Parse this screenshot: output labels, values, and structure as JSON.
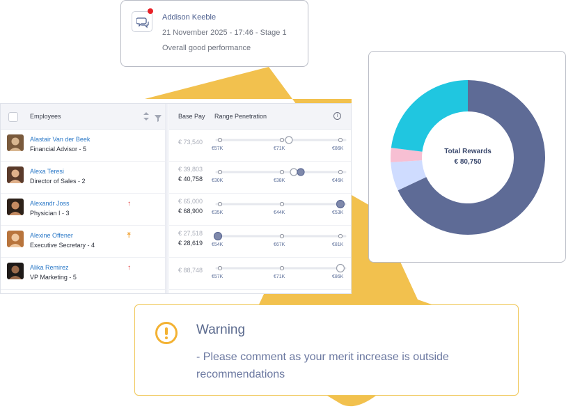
{
  "colors": {
    "accent_yellow": "#f2c14e",
    "link_blue": "#2a78c7",
    "navy": "#5e6b96",
    "warning": "#f3b233",
    "alert_red": "#e23a3a",
    "alert_orange": "#f0a030"
  },
  "notification": {
    "icon": "chat-icon",
    "name": "Addison Keeble",
    "meta": "21 November 2025 - 17:46 - Stage 1",
    "note": "Overall good performance"
  },
  "table": {
    "headers": {
      "employees": "Employees",
      "base_pay": "Base Pay",
      "range_penetration": "Range Penetration",
      "info_icon": "i"
    },
    "rows": [
      {
        "name": "Alastair Van der Beek",
        "title": "Financial Advisor - 5",
        "flag": "",
        "base_old": "€ 73,540",
        "base_new": "",
        "ticks": [
          "€57K",
          "€71K",
          "€86K"
        ],
        "marker": "€71K"
      },
      {
        "name": "Alexa Teresi",
        "title": "Director of Sales - 2",
        "flag": "",
        "base_old": "€ 39,803",
        "base_new": "€ 40,758",
        "ticks": [
          "€30K",
          "€38K",
          "€46K"
        ],
        "marker": "€38K"
      },
      {
        "name": "Alexandr Joss",
        "title": "Physician I - 3",
        "flag": "↑",
        "flag_color": "#e23a3a",
        "base_old": "€ 65,000",
        "base_new": "€ 68,900",
        "ticks": [
          "€35K",
          "€44K",
          "€53K"
        ],
        "marker": "€53K"
      },
      {
        "name": "Alexine Offener",
        "title": "Executive Secretary - 4",
        "flag": "⤒",
        "flag_color": "#f0a030",
        "base_old": "€ 27,518",
        "base_new": "€ 28,619",
        "ticks": [
          "€54K",
          "€67K",
          "€81K"
        ],
        "marker": "€54K"
      },
      {
        "name": "Alika Remirez",
        "title": "VP Marketing - 5",
        "flag": "↑",
        "flag_color": "#e23a3a",
        "base_old": "€ 88,748",
        "base_new": "",
        "ticks": [
          "€57K",
          "€71K",
          "€86K"
        ],
        "marker": "€86K"
      }
    ]
  },
  "donut": {
    "title": "Total Rewards",
    "total": "€ 80,750",
    "segments": [
      {
        "color": "#5e6b96",
        "share": 0.68
      },
      {
        "color": "#cfdcff",
        "share": 0.06
      },
      {
        "color": "#f7bfd3",
        "share": 0.03
      },
      {
        "color": "#20c6e0",
        "share": 0.23
      }
    ]
  },
  "warning": {
    "icon": "warning-icon",
    "title": "Warning",
    "message": "- Please comment as your merit increase is outside recommendations"
  }
}
